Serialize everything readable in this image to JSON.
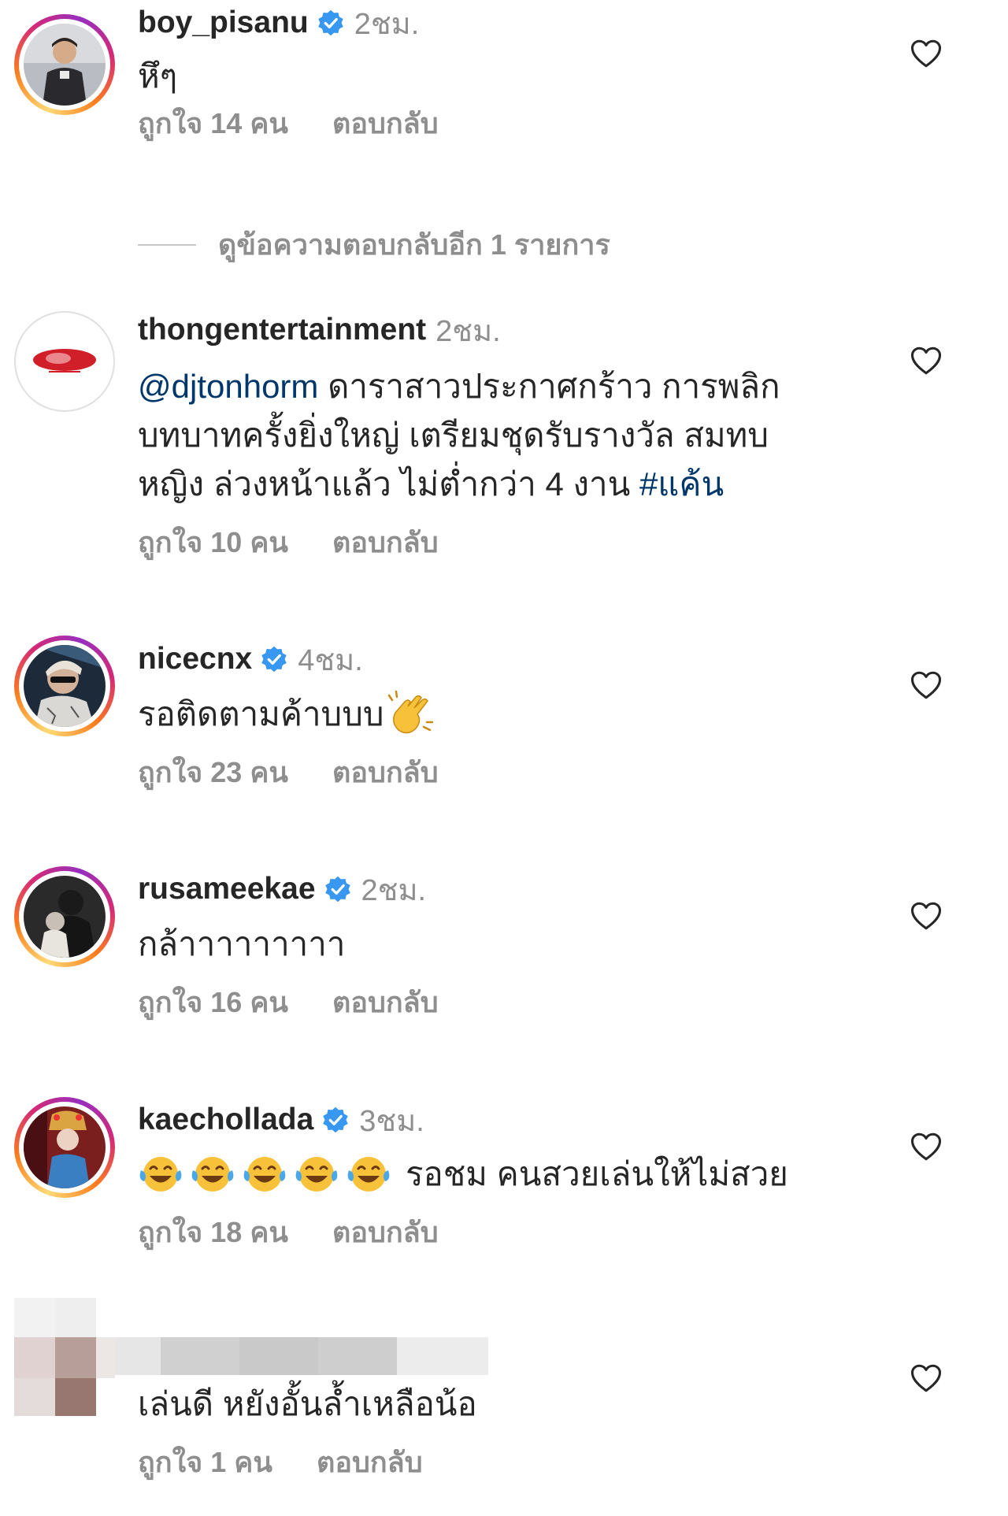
{
  "comments": [
    {
      "username": "boy_pisanu",
      "verified": true,
      "time": "2ชม.",
      "text": "หึๆ",
      "likes": "ถูกใจ 14 คน",
      "reply": "ตอบกลับ",
      "story_ring": true
    },
    {
      "username": "thongentertainment",
      "verified": false,
      "time": "2ชม.",
      "mention": "@djtonhorm",
      "text_line1": " ดาราสาวประกาศกร้าว การพลิก",
      "text_line2": "บทบาทครั้งยิ่งใหญ่ เตรียมชุดรับรางวัล สมทบ",
      "text_line3": "หญิง ล่วงหน้าแล้ว ไม่ต่ำกว่า 4 งาน ",
      "hashtag": "#แค้น",
      "likes": "ถูกใจ 10 คน",
      "reply": "ตอบกลับ",
      "story_ring": false
    },
    {
      "username": "nicecnx",
      "verified": true,
      "time": "4ชม.",
      "text": "รอติดตามค้าบบบ",
      "emoji": "clapping-hands",
      "likes": "ถูกใจ 23 คน",
      "reply": "ตอบกลับ",
      "story_ring": true
    },
    {
      "username": "rusameekae",
      "verified": true,
      "time": "2ชม.",
      "text": "กล้าาาาาาาาา",
      "likes": "ถูกใจ 16 คน",
      "reply": "ตอบกลับ",
      "story_ring": true
    },
    {
      "username": "kaechollada",
      "verified": true,
      "time": "3ชม.",
      "emoji": "face-with-tears-of-joy",
      "emoji_count": 5,
      "text": "รอชม คนสวยเล่นให้ไม่สวย",
      "likes": "ถูกใจ 18 คน",
      "reply": "ตอบกลับ",
      "story_ring": true
    },
    {
      "username_hidden": true,
      "text": "เล่นดี หยังอั้นล้ำเหลือน้อ",
      "likes": "ถูกใจ 1 คน",
      "reply": "ตอบกลับ"
    }
  ],
  "view_replies": "ดูข้อความตอบกลับอีก 1 รายการ",
  "colors": {
    "text": "#262626",
    "secondary": "#8e8e8e",
    "link": "#00376b",
    "verified": "#3897f0"
  },
  "icons": {
    "like": "heart-outline-icon",
    "verified": "verified-badge-icon"
  }
}
